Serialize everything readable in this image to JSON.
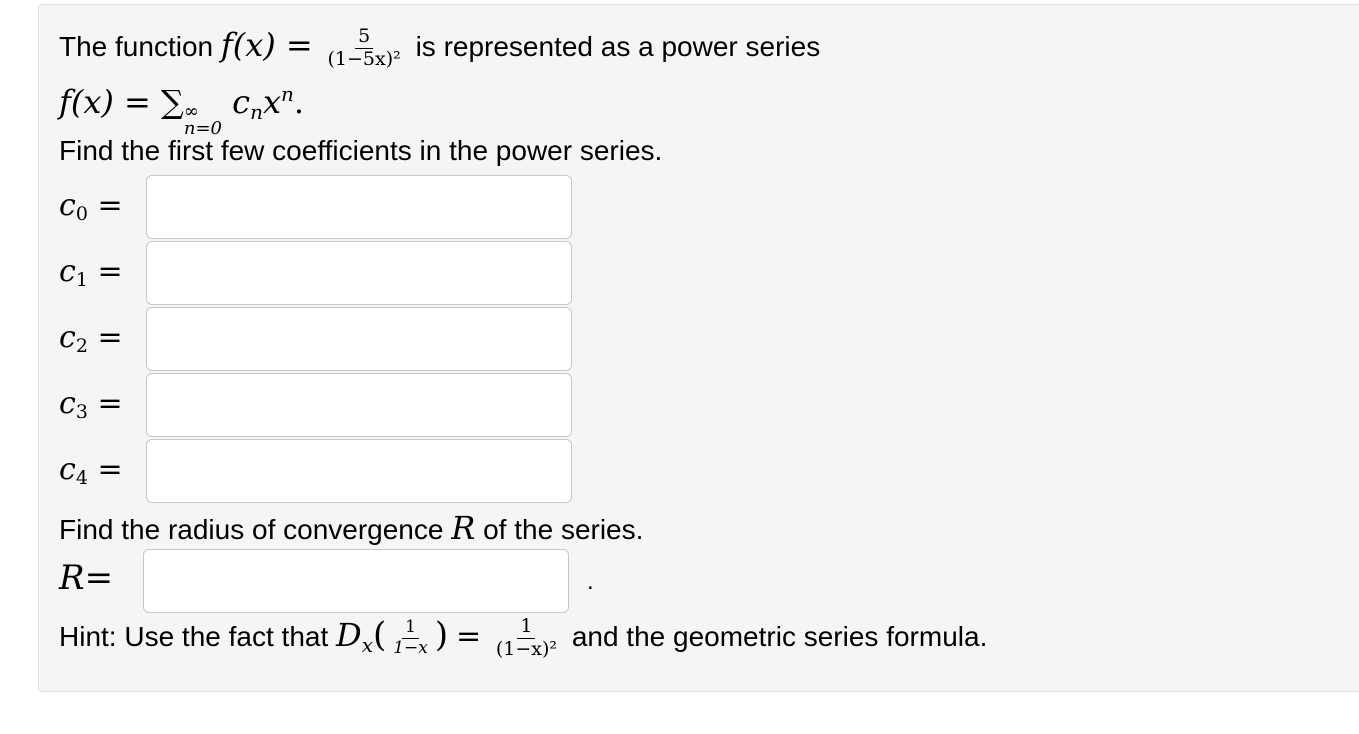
{
  "problem": {
    "intro_text": "The function",
    "f_x": "f(x) =",
    "frac_num": "5",
    "frac_den": "(1−5x)²",
    "intro_tail": "is represented as a power series",
    "series_lhs": "f(x) =",
    "series_sum": "∑",
    "series_sup": "∞",
    "series_sub": "n=0",
    "series_term_c": "c",
    "series_term_n": "n",
    "series_term_x": "x",
    "series_term_exp": "n",
    "series_end": ".",
    "find_coeffs": "Find the first few coefficients in the power series.",
    "find_radius_pre": "Find the radius of convergence",
    "radius_symbol": "R",
    "find_radius_post": "of the series.",
    "hint_pre": "Hint: Use the fact that",
    "hint_D": "D",
    "hint_D_sub": "x",
    "hint_inner_num": "1",
    "hint_inner_den": "1−x",
    "hint_eq": "=",
    "hint_rhs_num": "1",
    "hint_rhs_den": "(1−x)²",
    "hint_post": "and the geometric series formula."
  },
  "coefficients": [
    {
      "symbol": "c",
      "index": "0",
      "eq": "=",
      "value": ""
    },
    {
      "symbol": "c",
      "index": "1",
      "eq": "=",
      "value": ""
    },
    {
      "symbol": "c",
      "index": "2",
      "eq": "=",
      "value": ""
    },
    {
      "symbol": "c",
      "index": "3",
      "eq": "=",
      "value": ""
    },
    {
      "symbol": "c",
      "index": "4",
      "eq": "=",
      "value": ""
    }
  ],
  "radius": {
    "symbol": "R",
    "eq": "=",
    "value": "",
    "trailing": "."
  }
}
